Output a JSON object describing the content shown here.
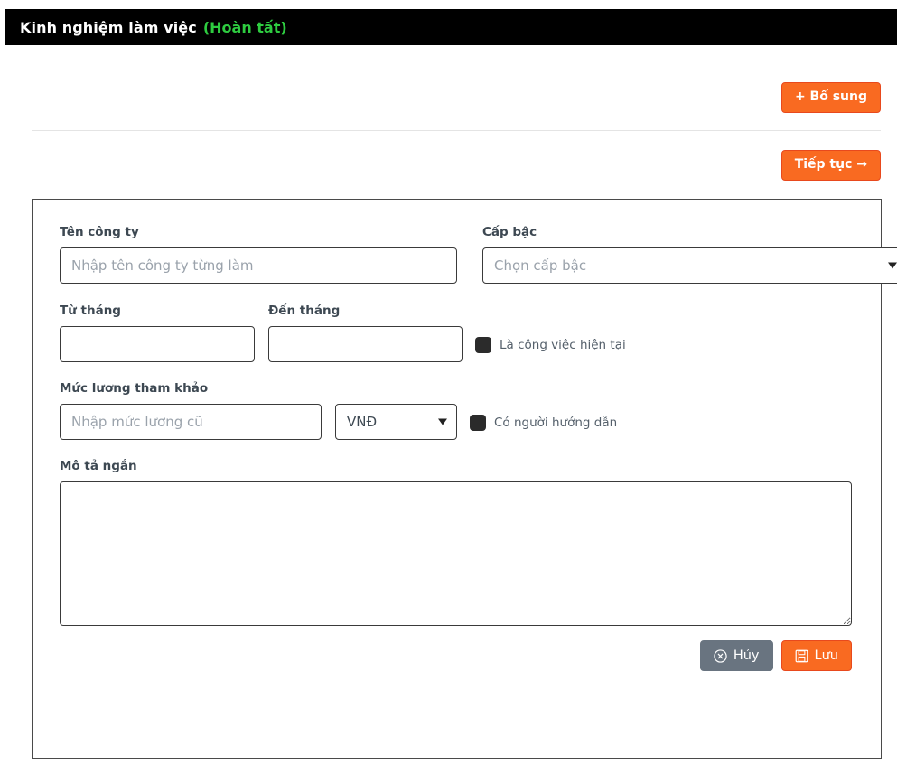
{
  "header": {
    "title": "Kinh nghiệm làm việc",
    "status": "(Hoàn tất)",
    "status_color": "#2ecc40",
    "background": "#000000"
  },
  "toolbar": {
    "add_label": "+ Bổ sung",
    "continue_label": "Tiếp tục →",
    "accent_color": "#f96a21"
  },
  "form": {
    "company": {
      "label": "Tên công ty",
      "placeholder": "Nhập tên công ty từng làm",
      "value": ""
    },
    "level": {
      "label": "Cấp bậc",
      "placeholder": "Chọn cấp bậc",
      "value": ""
    },
    "from_month": {
      "label": "Từ tháng",
      "placeholder": "",
      "value": ""
    },
    "to_month": {
      "label": "Đến tháng",
      "placeholder": "",
      "value": ""
    },
    "current_job": {
      "label": "Là công việc hiện tại",
      "checked": true
    },
    "salary": {
      "label": "Mức lương tham khảo",
      "placeholder": "Nhập mức lương cũ",
      "value": ""
    },
    "currency": {
      "value": "VNĐ"
    },
    "mentor": {
      "label": "Có người hướng dẫn",
      "checked": true
    },
    "description": {
      "label": "Mô tả ngắn",
      "placeholder": "",
      "value": ""
    }
  },
  "actions": {
    "cancel_label": "Hủy",
    "save_label": "Lưu"
  }
}
